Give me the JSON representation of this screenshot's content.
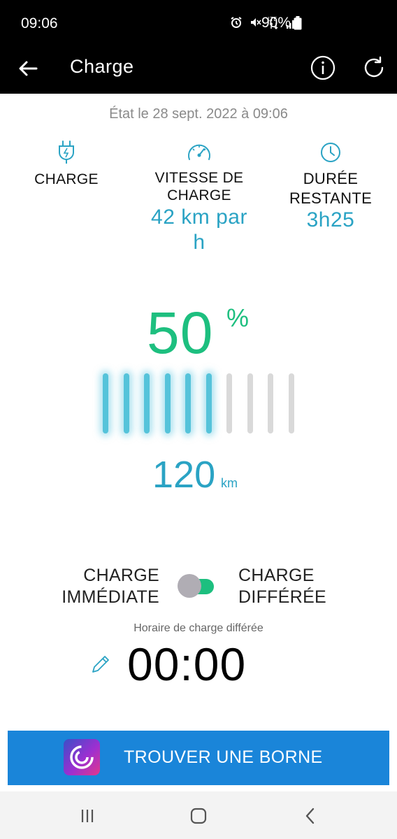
{
  "status_bar": {
    "time": "09:06",
    "network": "LTE",
    "battery_percent": "90%"
  },
  "app_bar": {
    "title": "Charge",
    "back_icon": "arrow-left-icon",
    "info_icon": "info-icon",
    "refresh_icon": "refresh-icon"
  },
  "state_text": "État le 28 sept. 2022 à 09:06",
  "stats": {
    "charge": {
      "label": "CHARGE",
      "icon": "plug-icon"
    },
    "speed": {
      "label_line1": "VITESSE DE",
      "label_line2": "CHARGE",
      "value_line1": "42 km par",
      "value_line2": "h",
      "icon": "speedometer-icon"
    },
    "remaining": {
      "label_line1": "DURÉE",
      "label_line2": "RESTANTE",
      "value": "3h25",
      "icon": "clock-icon"
    }
  },
  "battery": {
    "percent": "50",
    "percent_sign": "%",
    "level_fraction": 0.5,
    "bars_total": 10,
    "bars_filled": 6,
    "range_value": "120",
    "range_unit": "km"
  },
  "charge_mode": {
    "left_line1": "CHARGE",
    "left_line2": "IMMÉDIATE",
    "right_line1": "CHARGE",
    "right_line2": "DIFFÉRÉE",
    "deferred_enabled": true
  },
  "schedule": {
    "label": "Horaire de charge différée",
    "time": "00:00",
    "edit_icon": "pencil-icon"
  },
  "find_button": {
    "label": "TROUVER UNE BORNE",
    "logo_icon": "charging-network-logo"
  },
  "nav_bar": {
    "recent_icon": "recent-apps-icon",
    "home_icon": "home-icon",
    "back_icon": "back-chevron-icon"
  },
  "colors": {
    "accent_blue": "#2aa3c4",
    "accent_green": "#1dbf7f",
    "button_blue": "#1a85d9"
  }
}
